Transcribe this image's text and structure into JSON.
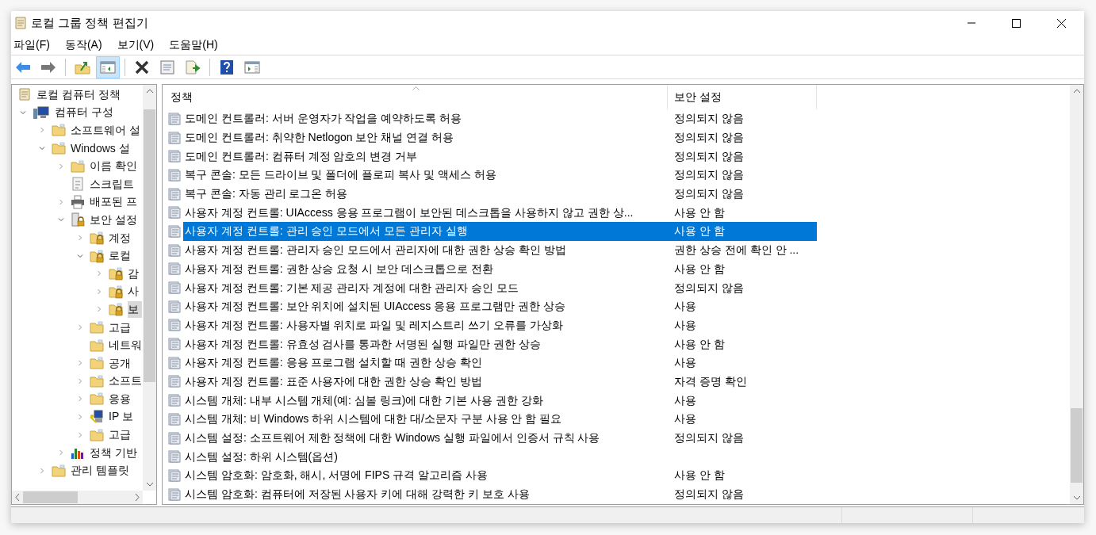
{
  "window": {
    "title": "로컬 그룹 정책 편집기"
  },
  "menu": [
    "파일(F)",
    "동작(A)",
    "보기(V)",
    "도움말(H)"
  ],
  "toolbar": [
    {
      "kind": "back",
      "pressed": false
    },
    {
      "kind": "forward",
      "pressed": false
    },
    {
      "kind": "up",
      "pressed": false
    },
    {
      "kind": "tree",
      "pressed": true
    },
    {
      "kind": "delete",
      "pressed": false
    },
    {
      "kind": "properties",
      "pressed": false
    },
    {
      "kind": "export",
      "pressed": false
    },
    {
      "kind": "help",
      "pressed": false
    },
    {
      "kind": "pane",
      "pressed": false
    }
  ],
  "tree": [
    {
      "label": "로컬 컴퓨터 정책",
      "kind": "policy",
      "selected": false,
      "children": [
        {
          "label": "컴퓨터 구성",
          "kind": "computer",
          "expanded": true,
          "selected": false,
          "children": [
            {
              "label": "소프트웨어 설",
              "kind": "folder",
              "expanded": false,
              "selected": false
            },
            {
              "label": "Windows 설",
              "kind": "folder",
              "expanded": true,
              "selected": false,
              "children": [
                {
                  "label": "이름 확인",
                  "kind": "folder",
                  "expanded": false,
                  "selected": false
                },
                {
                  "label": "스크립트",
                  "kind": "script",
                  "selected": false
                },
                {
                  "label": "배포된 프",
                  "kind": "printer",
                  "expanded": false,
                  "selected": false
                },
                {
                  "label": "보안 설정",
                  "kind": "secure",
                  "expanded": true,
                  "selected": false,
                  "children": [
                    {
                      "label": "계정",
                      "kind": "lockfolder",
                      "expanded": false,
                      "selected": false
                    },
                    {
                      "label": "로컬",
                      "kind": "lockfolder",
                      "expanded": true,
                      "selected": false,
                      "children": [
                        {
                          "label": "감",
                          "kind": "lockfolder",
                          "expanded": false,
                          "selected": false
                        },
                        {
                          "label": "사",
                          "kind": "lockfolder",
                          "expanded": false,
                          "selected": false
                        },
                        {
                          "label": "보",
                          "kind": "lockfolder",
                          "expanded": false,
                          "selected": true
                        }
                      ]
                    },
                    {
                      "label": "고급",
                      "kind": "folder",
                      "expanded": false,
                      "selected": false
                    },
                    {
                      "label": "네트워",
                      "kind": "folder",
                      "selected": false
                    },
                    {
                      "label": "공개",
                      "kind": "folder",
                      "expanded": false,
                      "selected": false
                    },
                    {
                      "label": "소프트",
                      "kind": "folder",
                      "expanded": false,
                      "selected": false
                    },
                    {
                      "label": "응용",
                      "kind": "folder",
                      "expanded": false,
                      "selected": false
                    },
                    {
                      "label": "IP 보",
                      "kind": "ipsec",
                      "expanded": false,
                      "selected": false
                    },
                    {
                      "label": "고급",
                      "kind": "folder",
                      "expanded": false,
                      "selected": false
                    }
                  ]
                },
                {
                  "label": "정책 기반",
                  "kind": "chart",
                  "expanded": false,
                  "selected": false
                }
              ]
            },
            {
              "label": "관리 템플릿",
              "kind": "folder",
              "expanded": false,
              "selected": false
            }
          ]
        }
      ]
    }
  ],
  "table": {
    "columns": [
      "정책",
      "보안 설정"
    ],
    "rows": [
      {
        "policy": "도메인 컨트롤러: 서버 운영자가 작업을 예약하도록 허용",
        "setting": "정의되지 않음",
        "selected": false
      },
      {
        "policy": "도메인 컨트롤러: 취약한 Netlogon 보안 채널 연결 허용",
        "setting": "정의되지 않음",
        "selected": false
      },
      {
        "policy": "도메인 컨트롤러: 컴퓨터 계정 암호의 변경 거부",
        "setting": "정의되지 않음",
        "selected": false
      },
      {
        "policy": "복구 콘솔: 모든 드라이브 및 폴더에 플로피 복사 및 액세스 허용",
        "setting": "정의되지 않음",
        "selected": false
      },
      {
        "policy": "복구 콘솔: 자동 관리 로그온 허용",
        "setting": "정의되지 않음",
        "selected": false
      },
      {
        "policy": "사용자 계정 컨트롤: UIAccess 응용 프로그램이 보안된 데스크톱을 사용하지 않고 권한 상...",
        "setting": "사용 안 함",
        "selected": false
      },
      {
        "policy": "사용자 계정 컨트롤: 관리 승인 모드에서 모든 관리자 실행",
        "setting": "사용 안 함",
        "selected": true
      },
      {
        "policy": "사용자 계정 컨트롤: 관리자 승인 모드에서 관리자에 대한 권한 상승 확인 방법",
        "setting": "권한 상승 전에 확인 안 ...",
        "selected": false
      },
      {
        "policy": "사용자 계정 컨트롤: 권한 상승 요청 시 보안 데스크톱으로 전환",
        "setting": "사용 안 함",
        "selected": false
      },
      {
        "policy": "사용자 계정 컨트롤: 기본 제공 관리자 계정에 대한 관리자 승인 모드",
        "setting": "정의되지 않음",
        "selected": false
      },
      {
        "policy": "사용자 계정 컨트롤: 보안 위치에 설치된 UIAccess 응용 프로그램만 권한 상승",
        "setting": "사용",
        "selected": false
      },
      {
        "policy": "사용자 계정 컨트롤: 사용자별 위치로 파일 및 레지스트리 쓰기 오류를 가상화",
        "setting": "사용",
        "selected": false
      },
      {
        "policy": "사용자 계정 컨트롤: 유효성 검사를 통과한 서명된 실행 파일만 권한 상승",
        "setting": "사용 안 함",
        "selected": false
      },
      {
        "policy": "사용자 계정 컨트롤: 응용 프로그램 설치할 때 권한 상승 확인",
        "setting": "사용",
        "selected": false
      },
      {
        "policy": "사용자 계정 컨트롤: 표준 사용자에 대한 권한 상승 확인 방법",
        "setting": "자격 증명 확인",
        "selected": false
      },
      {
        "policy": "시스템 개체: 내부 시스템 개체(예: 심볼 링크)에 대한 기본 사용 권한 강화",
        "setting": "사용",
        "selected": false
      },
      {
        "policy": "시스템 개체: 비 Windows 하위 시스템에 대한 대/소문자 구분 사용 안 함 필요",
        "setting": "사용",
        "selected": false
      },
      {
        "policy": "시스템 설정: 소프트웨어 제한 정책에 대한 Windows 실행 파일에서 인증서 규칙 사용",
        "setting": "정의되지 않음",
        "selected": false
      },
      {
        "policy": "시스템 설정: 하위 시스템(옵션)",
        "selected": false
      },
      {
        "policy": "시스템 암호화: 암호화, 해시, 서명에 FIPS 규격 알고리즘 사용",
        "setting": "사용 안 함",
        "selected": false
      },
      {
        "policy": "시스템 암호화: 컴퓨터에 저장된 사용자 키에 대해 강력한 키 보호 사용",
        "setting": "정의되지 않음",
        "selected": false
      }
    ]
  }
}
